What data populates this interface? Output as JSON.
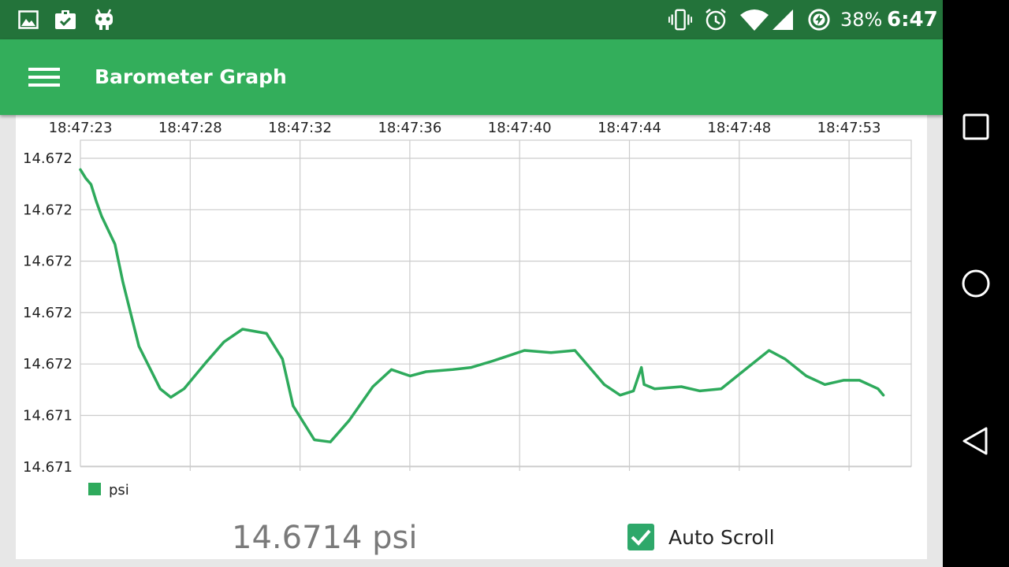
{
  "status_bar": {
    "battery_percent": "38%",
    "time": "6:47",
    "icons_left": [
      "image-icon",
      "clipboard-check-icon",
      "android-icon"
    ],
    "icons_right": [
      "vibrate-icon",
      "alarm-icon",
      "wifi-icon",
      "signal-icon",
      "battery-saver-icon"
    ]
  },
  "toolbar": {
    "title": "Barometer Graph",
    "menu_icon": "hamburger-menu-icon"
  },
  "readout": {
    "value": "14.6714 psi"
  },
  "auto_scroll": {
    "label": "Auto Scroll",
    "checked": true
  },
  "nav_bar": {
    "buttons": [
      "recents-square-icon",
      "home-circle-icon",
      "back-triangle-icon"
    ]
  },
  "colors": {
    "status_bar": "#23733a",
    "toolbar": "#33ae5b",
    "series": "#2eaa5c",
    "checkbox": "#2ea86a"
  },
  "chart_data": {
    "type": "line",
    "x_tick_labels": [
      "18:47:23",
      "18:47:28",
      "18:47:32",
      "18:47:36",
      "18:47:40",
      "18:47:44",
      "18:47:48",
      "18:47:53"
    ],
    "y_tick_labels": [
      "14.672",
      "14.672",
      "14.672",
      "14.672",
      "14.672",
      "14.671",
      "14.671"
    ],
    "grid": true,
    "legend_position": "bottom-left",
    "series": [
      {
        "name": "psi",
        "color": "#2eaa5c",
        "x_seconds_from_first_tick": [
          0,
          0.2,
          0.4,
          0.6,
          0.8,
          1.3,
          1.6,
          2.2,
          3.0,
          3.4,
          3.9,
          4.7,
          5.4,
          6.1,
          7.0,
          7.6,
          8.0,
          8.8,
          9.4,
          10.1,
          11.0,
          11.7,
          12.4,
          13.0,
          14.0,
          14.7,
          15.5,
          16.7,
          17.7,
          18.6,
          19.7,
          20.3,
          20.8,
          21.1,
          21.2,
          21.6,
          22.6,
          23.3,
          24.1,
          25.1,
          25.9,
          26.5,
          27.3,
          28.0,
          28.7,
          29.3,
          30.0,
          30.2
        ],
        "values": [
          14.67203,
          14.67199,
          14.67196,
          14.67188,
          14.67181,
          14.67168,
          14.6715,
          14.6712,
          14.671,
          14.67096,
          14.671,
          14.67112,
          14.67122,
          14.67128,
          14.67126,
          14.67114,
          14.67092,
          14.67076,
          14.67075,
          14.67085,
          14.67101,
          14.67109,
          14.67106,
          14.67108,
          14.67109,
          14.6711,
          14.67113,
          14.67118,
          14.67117,
          14.67118,
          14.67102,
          14.67097,
          14.67099,
          14.6711,
          14.67102,
          14.671,
          14.67101,
          14.67099,
          14.671,
          14.6711,
          14.67118,
          14.67114,
          14.67106,
          14.67102,
          14.67104,
          14.67104,
          14.671,
          14.67097
        ]
      }
    ]
  }
}
